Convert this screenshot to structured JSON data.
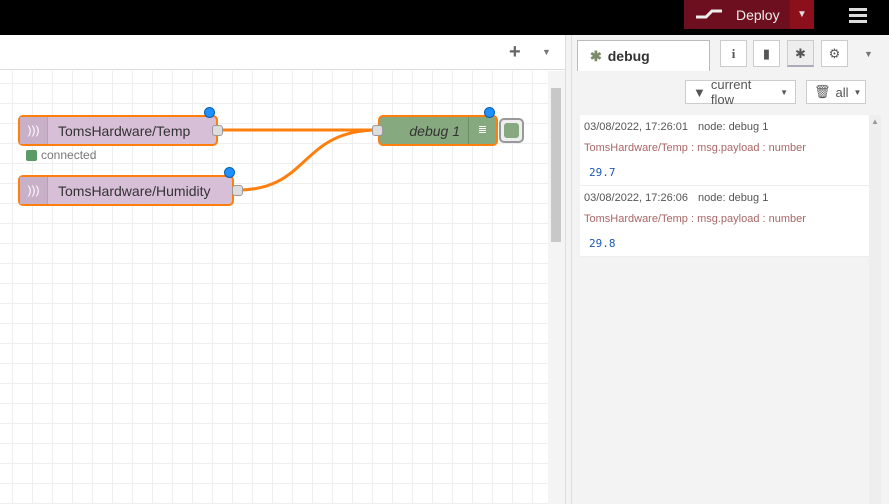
{
  "header": {
    "deploy_label": "Deploy"
  },
  "flow": {
    "nodes": [
      {
        "label": "TomsHardware/Temp",
        "status": "connected"
      },
      {
        "label": "TomsHardware/Humidity"
      },
      {
        "label": "debug 1"
      }
    ]
  },
  "sidebar": {
    "tab_label": "debug",
    "filter_label": "current flow",
    "clear_label": "all",
    "messages": [
      {
        "time": "03/08/2022, 17:26:01",
        "node": "node: debug 1",
        "topic": "TomsHardware/Temp : msg.payload : number",
        "value": "29.7"
      },
      {
        "time": "03/08/2022, 17:26:06",
        "node": "node: debug 1",
        "topic": "TomsHardware/Temp : msg.payload : number",
        "value": "29.8"
      }
    ]
  },
  "colors": {
    "deploy": "#6d0f1e",
    "wire": "#ff7f0e",
    "mqtt_node": "#d8bfd8",
    "debug_node": "#87a980"
  }
}
